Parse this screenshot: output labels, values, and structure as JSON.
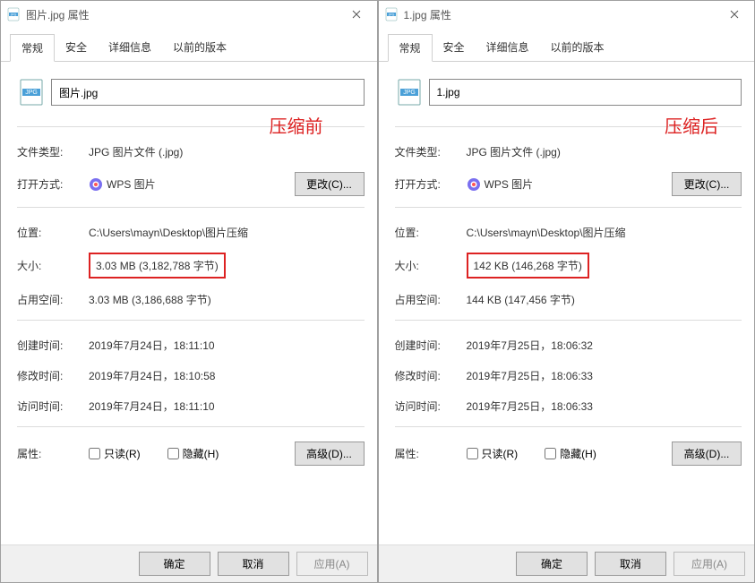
{
  "windows": [
    {
      "title": "图片.jpg 属性",
      "filename": "图片.jpg",
      "annotation": "压缩前",
      "filetype_label": "文件类型:",
      "filetype": "JPG 图片文件 (.jpg)",
      "opens_label": "打开方式:",
      "opens_app": "WPS 图片",
      "change_btn": "更改(C)...",
      "location_label": "位置:",
      "location": "C:\\Users\\mayn\\Desktop\\图片压缩",
      "size_label": "大小:",
      "size": "3.03 MB (3,182,788 字节)",
      "ondisk_label": "占用空间:",
      "ondisk": "3.03 MB (3,186,688 字节)",
      "created_label": "创建时间:",
      "created": "2019年7月24日，18:11:10",
      "modified_label": "修改时间:",
      "modified": "2019年7月24日，18:10:58",
      "accessed_label": "访问时间:",
      "accessed": "2019年7月24日，18:11:10",
      "attrs_label": "属性:",
      "readonly_label": "只读(R)",
      "hidden_label": "隐藏(H)",
      "advanced_btn": "高级(D)..."
    },
    {
      "title": "1.jpg 属性",
      "filename": "1.jpg",
      "annotation": "压缩后",
      "filetype_label": "文件类型:",
      "filetype": "JPG 图片文件 (.jpg)",
      "opens_label": "打开方式:",
      "opens_app": "WPS 图片",
      "change_btn": "更改(C)...",
      "location_label": "位置:",
      "location": "C:\\Users\\mayn\\Desktop\\图片压缩",
      "size_label": "大小:",
      "size": "142 KB (146,268 字节)",
      "ondisk_label": "占用空间:",
      "ondisk": "144 KB (147,456 字节)",
      "created_label": "创建时间:",
      "created": "2019年7月25日，18:06:32",
      "modified_label": "修改时间:",
      "modified": "2019年7月25日，18:06:33",
      "accessed_label": "访问时间:",
      "accessed": "2019年7月25日，18:06:33",
      "attrs_label": "属性:",
      "readonly_label": "只读(R)",
      "hidden_label": "隐藏(H)",
      "advanced_btn": "高级(D)..."
    }
  ],
  "tabs": [
    "常规",
    "安全",
    "详细信息",
    "以前的版本"
  ],
  "buttons": {
    "ok": "确定",
    "cancel": "取消",
    "apply": "应用(A)"
  }
}
